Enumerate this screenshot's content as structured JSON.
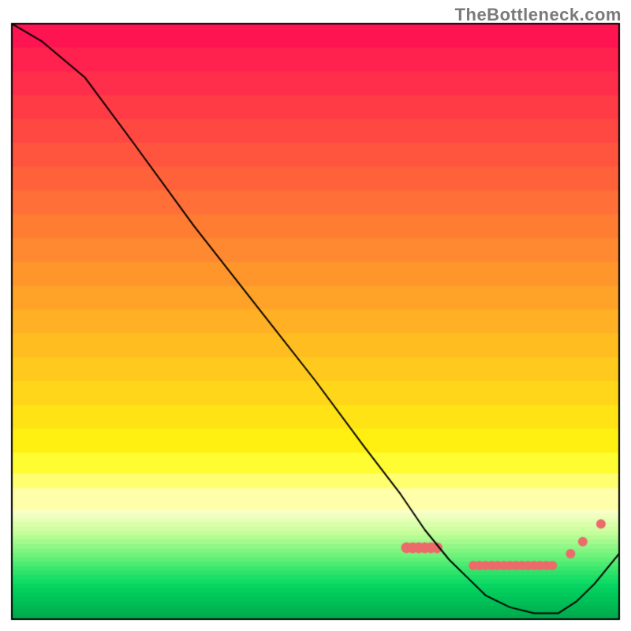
{
  "watermark": "TheBottleneck.com",
  "chart_data": {
    "type": "line",
    "title": "",
    "xlabel": "",
    "ylabel": "",
    "xlim": [
      0,
      100
    ],
    "ylim": [
      0,
      100
    ],
    "grid": false,
    "series": [
      {
        "name": "curve",
        "x": [
          0,
          5,
          12,
          20,
          30,
          40,
          50,
          58,
          64,
          68,
          72,
          75,
          78,
          82,
          86,
          90,
          93,
          96,
          100
        ],
        "y": [
          100,
          97,
          91,
          80,
          66,
          53,
          40,
          29,
          21,
          15,
          10,
          7,
          4,
          2,
          1,
          1,
          3,
          6,
          11
        ],
        "color": "#000000"
      }
    ],
    "markers": [
      {
        "x": 65,
        "y": 12,
        "color": "#ec6a6a",
        "r": 7
      },
      {
        "x": 66,
        "y": 12,
        "color": "#ec6a6a",
        "r": 7
      },
      {
        "x": 67,
        "y": 12,
        "color": "#ec6a6a",
        "r": 7
      },
      {
        "x": 68,
        "y": 12,
        "color": "#ec6a6a",
        "r": 7
      },
      {
        "x": 69,
        "y": 12,
        "color": "#ec6a6a",
        "r": 7
      },
      {
        "x": 70,
        "y": 12,
        "color": "#ec6a6a",
        "r": 7
      },
      {
        "x": 76,
        "y": 9,
        "color": "#ec6a6a",
        "r": 6
      },
      {
        "x": 77,
        "y": 9,
        "color": "#ec6a6a",
        "r": 6
      },
      {
        "x": 78,
        "y": 9,
        "color": "#ec6a6a",
        "r": 6
      },
      {
        "x": 79,
        "y": 9,
        "color": "#ec6a6a",
        "r": 6
      },
      {
        "x": 80,
        "y": 9,
        "color": "#ec6a6a",
        "r": 6
      },
      {
        "x": 81,
        "y": 9,
        "color": "#ec6a6a",
        "r": 6
      },
      {
        "x": 82,
        "y": 9,
        "color": "#ec6a6a",
        "r": 6
      },
      {
        "x": 83,
        "y": 9,
        "color": "#ec6a6a",
        "r": 6
      },
      {
        "x": 84,
        "y": 9,
        "color": "#ec6a6a",
        "r": 6
      },
      {
        "x": 85,
        "y": 9,
        "color": "#ec6a6a",
        "r": 6
      },
      {
        "x": 86,
        "y": 9,
        "color": "#ec6a6a",
        "r": 6
      },
      {
        "x": 87,
        "y": 9,
        "color": "#ec6a6a",
        "r": 6
      },
      {
        "x": 88,
        "y": 9,
        "color": "#ec6a6a",
        "r": 6
      },
      {
        "x": 89,
        "y": 9,
        "color": "#ec6a6a",
        "r": 6
      },
      {
        "x": 92,
        "y": 11,
        "color": "#ec6a6a",
        "r": 6
      },
      {
        "x": 94,
        "y": 13,
        "color": "#ec6a6a",
        "r": 6
      },
      {
        "x": 97,
        "y": 16,
        "color": "#ec6a6a",
        "r": 6
      }
    ],
    "background_gradient": {
      "top_rows": [
        {
          "h": 0.04,
          "color": "#ff1452"
        },
        {
          "h": 0.04,
          "color": "#ff214e"
        },
        {
          "h": 0.04,
          "color": "#ff2e4a"
        },
        {
          "h": 0.04,
          "color": "#ff3b46"
        },
        {
          "h": 0.04,
          "color": "#ff4842"
        },
        {
          "h": 0.04,
          "color": "#ff553f"
        },
        {
          "h": 0.04,
          "color": "#ff623b"
        },
        {
          "h": 0.04,
          "color": "#ff6f37"
        },
        {
          "h": 0.04,
          "color": "#ff7c33"
        },
        {
          "h": 0.04,
          "color": "#ff8930"
        },
        {
          "h": 0.04,
          "color": "#ff962c"
        },
        {
          "h": 0.04,
          "color": "#ffa328"
        },
        {
          "h": 0.04,
          "color": "#ffb024"
        },
        {
          "h": 0.04,
          "color": "#ffbd20"
        },
        {
          "h": 0.04,
          "color": "#ffca1d"
        },
        {
          "h": 0.04,
          "color": "#ffd619"
        },
        {
          "h": 0.04,
          "color": "#ffe315"
        },
        {
          "h": 0.04,
          "color": "#fff011"
        },
        {
          "h": 0.035,
          "color": "#fffc32"
        },
        {
          "h": 0.025,
          "color": "#ffff70"
        },
        {
          "h": 0.02,
          "color": "#feffa8"
        }
      ],
      "bottom_rows": [
        {
          "color": "#fbffca"
        },
        {
          "color": "#f0ffc0"
        },
        {
          "color": "#e5ffb6"
        },
        {
          "color": "#daffac"
        },
        {
          "color": "#cfffa2"
        },
        {
          "color": "#c4fd9a"
        },
        {
          "color": "#b3fb93"
        },
        {
          "color": "#a2f98d"
        },
        {
          "color": "#91f787"
        },
        {
          "color": "#80f581"
        },
        {
          "color": "#6ff37b"
        },
        {
          "color": "#5eef76"
        },
        {
          "color": "#4deb72"
        },
        {
          "color": "#3ce76e"
        },
        {
          "color": "#2ce36a"
        },
        {
          "color": "#1cdf67"
        },
        {
          "color": "#10db64"
        },
        {
          "color": "#08d561"
        },
        {
          "color": "#04cf5e"
        },
        {
          "color": "#02c95b"
        },
        {
          "color": "#01c358"
        },
        {
          "color": "#00bd55"
        },
        {
          "color": "#00b752"
        },
        {
          "color": "#00b150"
        },
        {
          "color": "#00ab4e"
        }
      ],
      "bottom_region": {
        "start": 0.815,
        "end": 1.0
      }
    },
    "frame": {
      "inset_left": 15,
      "inset_right": 15,
      "inset_top": 30,
      "inset_bottom": 15,
      "color": "#000000",
      "width": 2
    }
  }
}
